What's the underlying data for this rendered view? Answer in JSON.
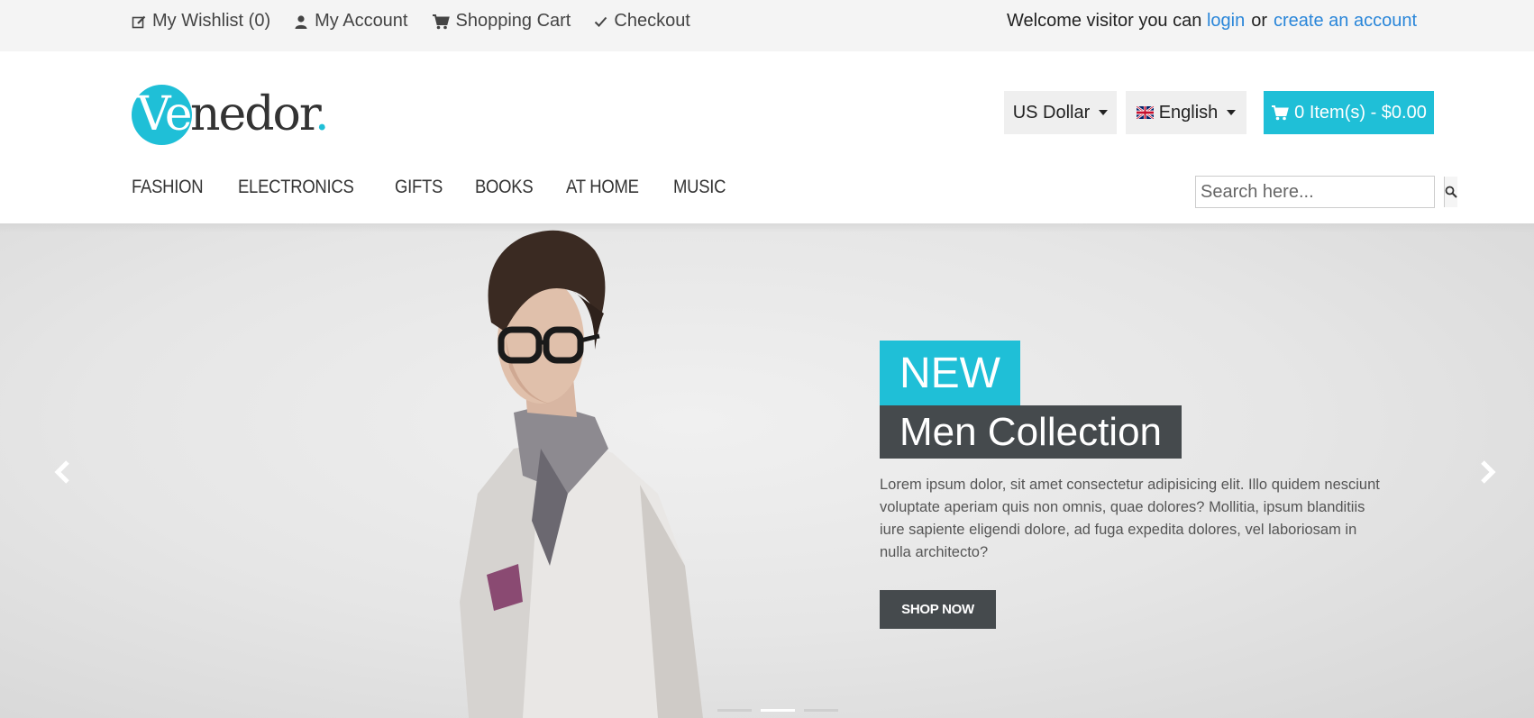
{
  "topbar": {
    "wishlist": "My Wishlist (0)",
    "account": "My Account",
    "cart": "Shopping Cart",
    "checkout": "Checkout",
    "welcome_text": "Welcome visitor you can",
    "login": "login",
    "or": "or",
    "create_account": "create an account"
  },
  "logo": {
    "ve": "Ve",
    "rest": "nedor",
    "dot": "."
  },
  "header": {
    "currency": "US Dollar",
    "language": "English",
    "cart": "0 Item(s) - $0.00"
  },
  "nav": [
    "FASHION",
    "ELECTRONICS",
    "GIFTS",
    "BOOKS",
    "AT HOME",
    "MUSIC"
  ],
  "search": {
    "placeholder": "Search here..."
  },
  "hero": {
    "tag": "NEW",
    "title": "Men Collection",
    "text": "Lorem ipsum dolor, sit amet consectetur adipisicing elit. Illo quidem nesciunt voluptate aperiam quis non omnis, quae dolores? Mollitia, ipsum blanditiis iure sapiente eligendi dolore, ad fuga expedita dolores, vel laboriosam in nulla architecto?",
    "button": "SHOP NOW",
    "active_slide": 2,
    "slide_count": 3
  },
  "colors": {
    "accent": "#1fbfd7",
    "dark": "#454a4d",
    "link": "#2a86d9"
  }
}
